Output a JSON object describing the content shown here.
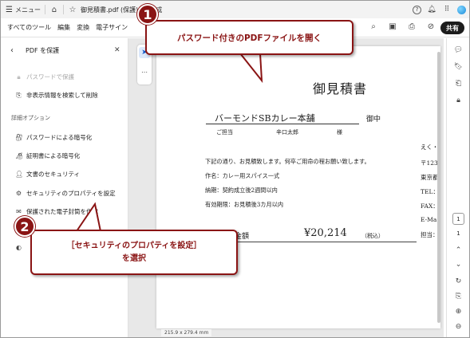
{
  "titlebar": {
    "menu_label": "メニュー",
    "home_icon": "home-icon",
    "star_icon": "star-icon",
    "document_title": "御見積書.pdf (保護)",
    "close_tab_icon": "close-icon",
    "new_tab_icon": "plus-icon",
    "edit_label": "作成",
    "right_icons": [
      "help-icon",
      "bell-icon",
      "apps-grid-icon",
      "avatar"
    ]
  },
  "toolbar": {
    "menus": [
      "すべてのツール",
      "編集",
      "変換",
      "電子サイン"
    ],
    "tool_icons": [
      "search-icon",
      "save-icon",
      "print-icon",
      "link-icon"
    ],
    "share_label": "共有"
  },
  "panel": {
    "title": "PDF を保護",
    "items_top": [
      {
        "label": "パスワードで保護",
        "icon": "lock-icon",
        "disabled": true
      },
      {
        "label": "非表示情報を検索して削除",
        "icon": "document-search-icon",
        "disabled": false
      }
    ],
    "section_label": "詳細オプション",
    "items_detail": [
      {
        "label": "パスワードによる暗号化",
        "icon": "lock-key-icon"
      },
      {
        "label": "証明書による暗号化",
        "icon": "certificate-lock-icon"
      },
      {
        "label": "文書のセキュリティ",
        "icon": "user-shield-icon"
      },
      {
        "label": "セキュリティのプロパティを設定",
        "icon": "security-settings-icon"
      },
      {
        "label": "保護された電子封筒を作成",
        "icon": "envelope-icon"
      }
    ]
  },
  "document": {
    "title": "御見積書",
    "company": "バーモンドSBカレー本舗",
    "honorific": "御中",
    "contact_label": "ご担当",
    "contact_name": "辛口太郎",
    "contact_honorific": "様",
    "intro": "下記の通り、お見積致します。何卒ご用命の程お願い致します。",
    "item_name": "作名：カレー用スパイス一式",
    "delivery": "納期：契約成立後2週間以内",
    "validity": "有効期限：お見積後3カ月以内",
    "total_label": "合計金額",
    "total_amount": "¥20,214",
    "tax_note": "（税込）",
    "right_column": [
      "えく・",
      "〒123",
      "東京都",
      "TEL：",
      "FAX：",
      "E-Ma",
      "担当："
    ]
  },
  "viewer": {
    "page_size": "215.9 x 279.4 mm",
    "current_page": "1",
    "total_pages": "1"
  },
  "callouts": {
    "step1_number": "1",
    "step1_text": "パスワード付きのPDFファイルを開く",
    "step2_number": "2",
    "step2_line1": "［セキュリティのプロパティを設定］",
    "step2_line2": "を選択"
  },
  "colors": {
    "callout": "#8a1414",
    "share_button": "#1c1c1c",
    "selected_tool": "#dbe8fb"
  }
}
